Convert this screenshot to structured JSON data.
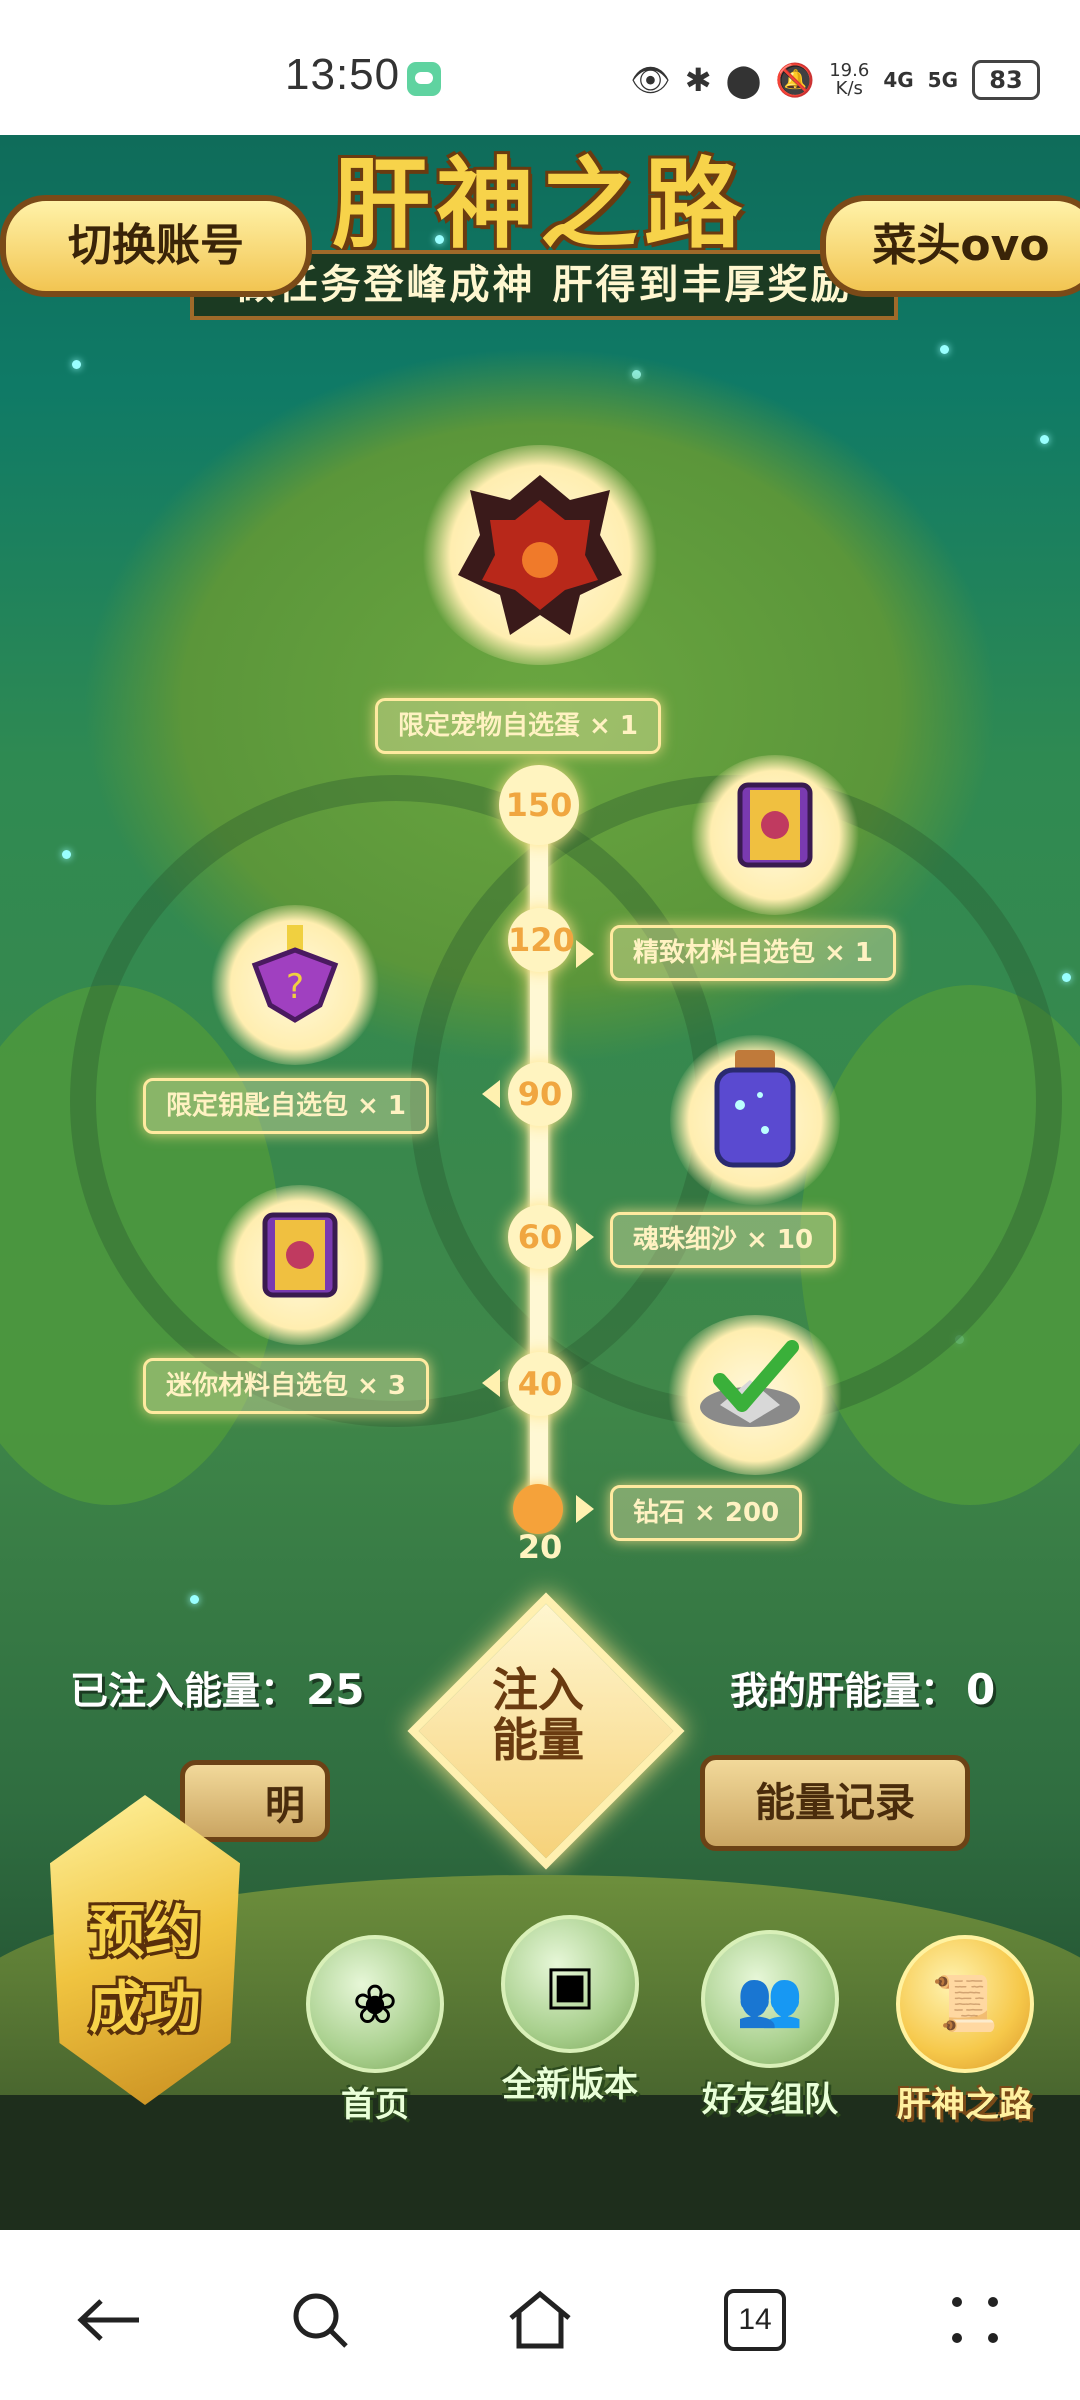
{
  "status_bar": {
    "time": "13:50",
    "speed_value": "19.6",
    "speed_unit": "K/s",
    "net1": "4G",
    "net2": "5G",
    "battery": "83"
  },
  "header": {
    "title": "肝神之路",
    "subtitle": "做任务登峰成神 肝得到丰厚奖励",
    "switch_account": "切换账号",
    "username": "菜头ovo"
  },
  "milestones": [
    "150",
    "120",
    "90",
    "60",
    "40",
    "20"
  ],
  "rewards": {
    "top": "限定宠物自选蛋 × 1",
    "r120": "精致材料自选包 × 1",
    "r90": "限定钥匙自选包 × 1",
    "r60": "魂珠细沙 × 10",
    "r40": "迷你材料自选包 × 3",
    "r20": "钻石 × 200"
  },
  "counters": {
    "injected_label": "已注入能量：",
    "injected_value": "25",
    "mine_label": "我的肝能量：",
    "mine_value": "0"
  },
  "inject_button": {
    "line1": "注入",
    "line2": "能量"
  },
  "buttons": {
    "record": "能量记录",
    "rules": "明"
  },
  "reservation": {
    "line1": "预约",
    "line2": "成功"
  },
  "bottom_nav": [
    "首页",
    "全新版本",
    "好友组队",
    "肝神之路"
  ],
  "system_nav": {
    "tabs": "14"
  },
  "colors": {
    "accent": "#f5a23a",
    "glow": "#ffe48a",
    "pill_text": "#fff2c2"
  }
}
